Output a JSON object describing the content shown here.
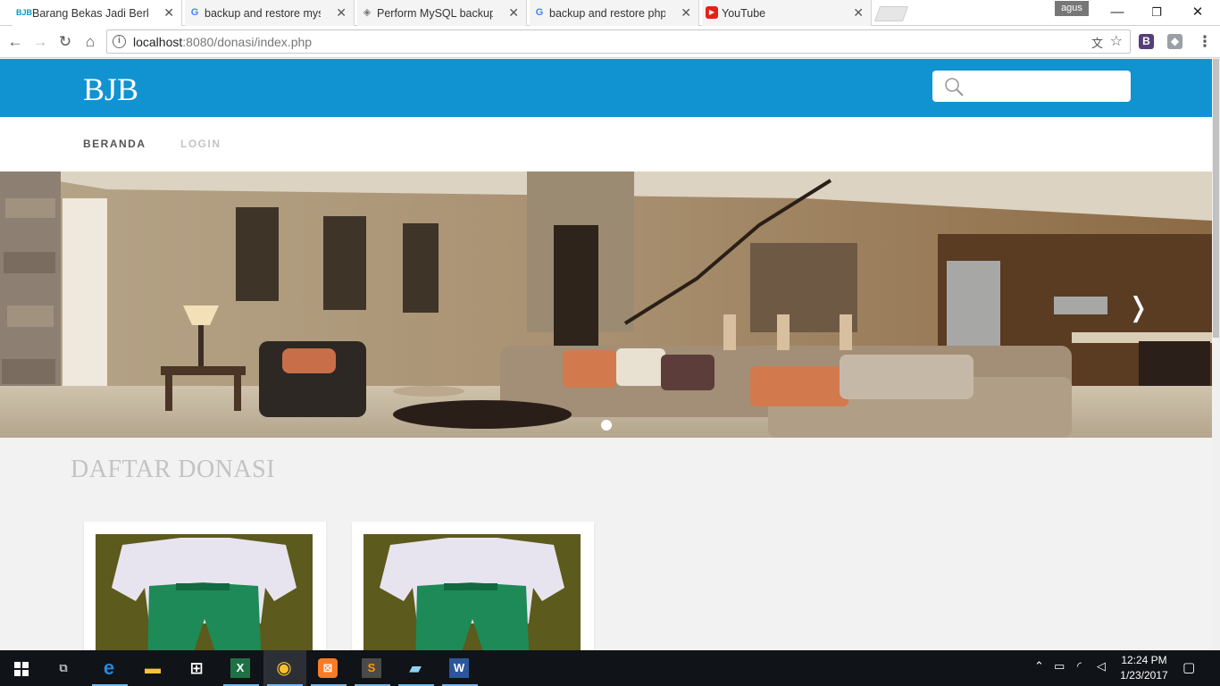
{
  "browser": {
    "tabs": [
      {
        "label": "Barang Bekas Jadi Berkah",
        "favicon": "BJB"
      },
      {
        "label": "backup and restore mysql",
        "favicon": "G"
      },
      {
        "label": "Perform MySQL backup and",
        "favicon": "◈"
      },
      {
        "label": "backup and restore php",
        "favicon": "G"
      },
      {
        "label": "YouTube",
        "favicon": "▶"
      }
    ],
    "profile_name": "agus",
    "address": {
      "host": "localhost",
      "path": ":8080/donasi/index.php"
    },
    "extensions": [
      {
        "name": "bootstrap-extension-icon",
        "letter": "B",
        "color": "#563d7c"
      },
      {
        "name": "extension-cube-icon",
        "letter": "◆",
        "color": "#9aa0a6"
      }
    ]
  },
  "site": {
    "logo": "BJB",
    "search_placeholder": "",
    "menu": [
      {
        "label": "BERANDA"
      },
      {
        "label": "LOGIN"
      }
    ],
    "slider": {
      "next_label": "❭",
      "active_slide": 1,
      "total_slides": 1
    },
    "section_title": "DAFTAR DONASI",
    "cards": [
      {
        "image": "school uniform: white shirt and green trousers"
      },
      {
        "image": "school uniform: white shirt and green trousers"
      }
    ],
    "colors": {
      "header": "#1193d1",
      "menu_active": "#555555",
      "menu_inactive": "#c4c4c4"
    }
  },
  "taskbar": {
    "apps": [
      {
        "name": "task-view",
        "glyph": "⧉"
      },
      {
        "name": "edge",
        "glyph": "e"
      },
      {
        "name": "file-explorer",
        "glyph": "▬"
      },
      {
        "name": "store",
        "glyph": "⊞"
      },
      {
        "name": "excel",
        "glyph": "X"
      },
      {
        "name": "chrome",
        "glyph": "◉"
      },
      {
        "name": "xampp",
        "glyph": "⊠"
      },
      {
        "name": "sublime-text",
        "glyph": "S"
      },
      {
        "name": "notepad",
        "glyph": "▰"
      },
      {
        "name": "word",
        "glyph": "W"
      }
    ],
    "time": "12:24 PM",
    "date": "1/23/2017"
  }
}
